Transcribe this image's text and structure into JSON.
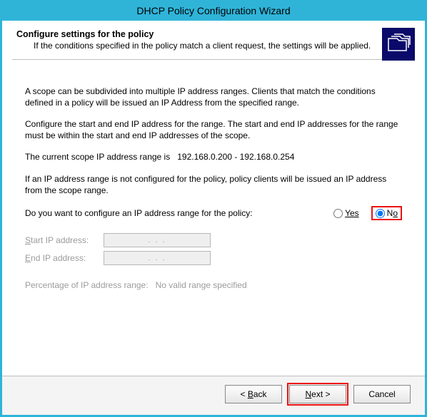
{
  "window": {
    "title": "DHCP Policy Configuration Wizard"
  },
  "header": {
    "title": "Configure settings for the policy",
    "subtitle": "If the conditions specified in the policy match a client request, the settings will be applied.",
    "icon": "folders-icon"
  },
  "body": {
    "para1": "A scope can be subdivided into multiple IP address ranges. Clients that match the conditions defined in a policy will be issued an IP Address from the specified range.",
    "para2": "Configure the start and end IP address for the range. The start and end IP addresses for the range must be within the start and end IP addresses of the scope.",
    "para3_prefix": "The current scope IP address range is",
    "para3_range": "192.168.0.200 - 192.168.0.254",
    "para4": "If an IP address range is not configured for the policy, policy clients will be issued an IP address from the scope range.",
    "question": "Do you want to configure an IP address range for the policy:",
    "yes_label": "Yes",
    "no_label": "No",
    "selected": "no",
    "start_label": "Start IP address:",
    "end_label": "End IP address:",
    "start_value": ".   .   .",
    "end_value": ".   .   .",
    "pct_label": "Percentage of IP address range:",
    "pct_value": "No valid range specified"
  },
  "footer": {
    "back": "< Back",
    "next": "Next >",
    "cancel": "Cancel"
  }
}
